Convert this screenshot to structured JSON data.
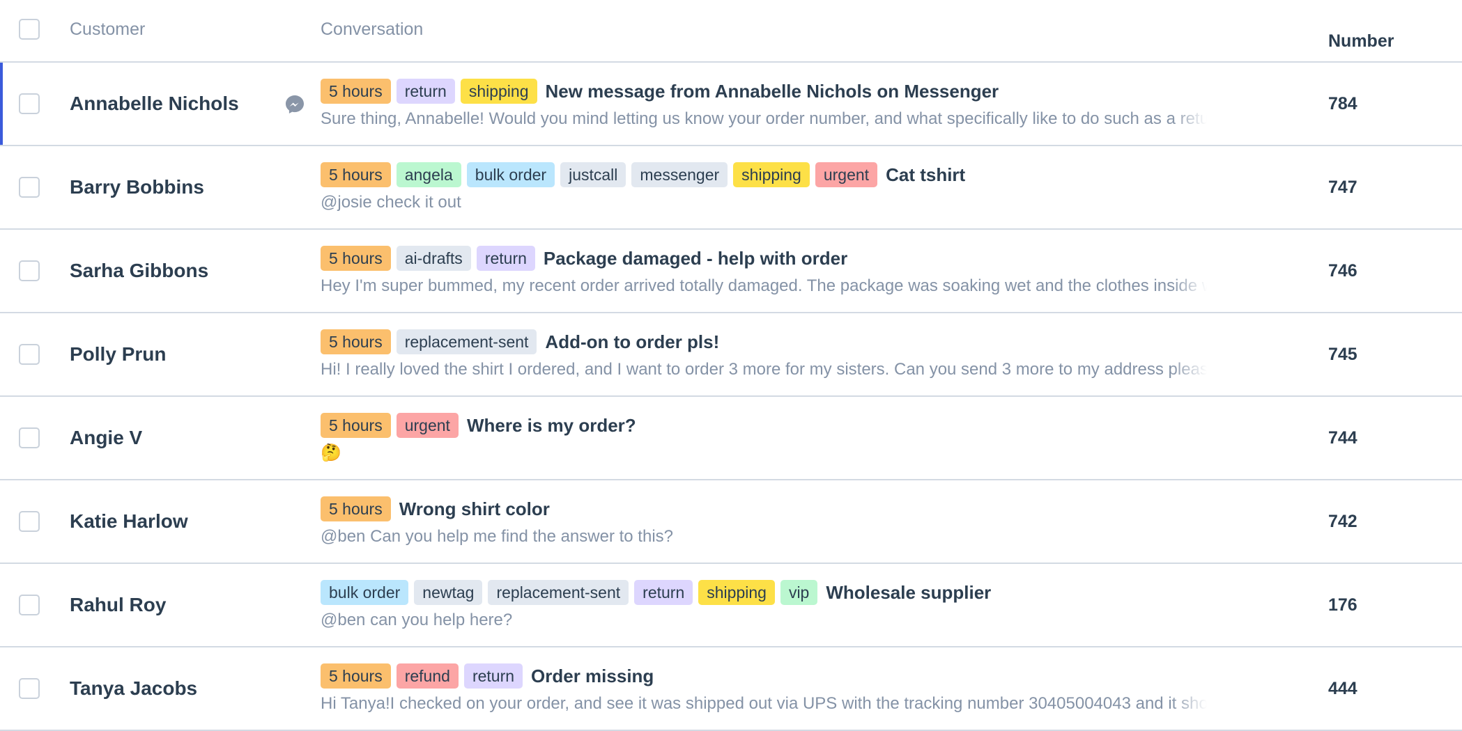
{
  "header": {
    "customer": "Customer",
    "conversation": "Conversation",
    "number": "Number"
  },
  "colors": {
    "accent": "#3b5bdb",
    "text": "#2c3e50",
    "muted": "#8492a6",
    "border": "#d3dae3",
    "tag_orange": "#fbbf6d",
    "tag_purple": "#ddd6fe",
    "tag_yellow": "#fde047",
    "tag_green": "#bbf7d0",
    "tag_blue": "#bae6fd",
    "tag_gray": "#e2e8f0",
    "tag_red": "#fca5a5",
    "messenger_icon": "#8a96a8"
  },
  "rows": [
    {
      "customer": "Annabelle Nichols",
      "selected": true,
      "channel_icon": "messenger-icon",
      "tags": [
        {
          "label": "5 hours",
          "color": "orange"
        },
        {
          "label": "return",
          "color": "purple"
        },
        {
          "label": "shipping",
          "color": "yellow"
        }
      ],
      "subject": "New message from Annabelle Nichols on Messenger",
      "snippet": "Sure thing, Annabelle! Would you mind letting us know your order number, and what specifically like to do such as a return or exchange?",
      "number": "784"
    },
    {
      "customer": "Barry Bobbins",
      "tags": [
        {
          "label": "5 hours",
          "color": "orange"
        },
        {
          "label": "angela",
          "color": "green"
        },
        {
          "label": "bulk order",
          "color": "blue"
        },
        {
          "label": "justcall",
          "color": "gray"
        },
        {
          "label": "messenger",
          "color": "gray"
        },
        {
          "label": "shipping",
          "color": "yellow"
        },
        {
          "label": "urgent",
          "color": "red"
        }
      ],
      "subject": "Cat tshirt",
      "snippet": "@josie check it out",
      "number": "747"
    },
    {
      "customer": "Sarha Gibbons",
      "tags": [
        {
          "label": "5 hours",
          "color": "orange"
        },
        {
          "label": "ai-drafts",
          "color": "gray"
        },
        {
          "label": "return",
          "color": "purple"
        }
      ],
      "subject": "Package damaged - help with order",
      "snippet": "Hey I'm super bummed, my recent order arrived totally damaged. The package was soaking wet and the clothes inside were ruined.",
      "number": "746"
    },
    {
      "customer": "Polly Prun",
      "tags": [
        {
          "label": "5 hours",
          "color": "orange"
        },
        {
          "label": "replacement-sent",
          "color": "gray"
        }
      ],
      "subject": "Add-on to order pls!",
      "snippet": "Hi! I really loved the shirt I ordered, and I want to order 3 more for my sisters. Can you send 3 more to my address please?",
      "number": "745"
    },
    {
      "customer": "Angie V",
      "tags": [
        {
          "label": "5 hours",
          "color": "orange"
        },
        {
          "label": "urgent",
          "color": "red"
        }
      ],
      "subject": "Where is my order?",
      "snippet": "🤔",
      "number": "744"
    },
    {
      "customer": "Katie Harlow",
      "tags": [
        {
          "label": "5 hours",
          "color": "orange"
        }
      ],
      "subject": "Wrong shirt color",
      "snippet": "@ben Can you help me find the answer to this?",
      "number": "742"
    },
    {
      "customer": "Rahul Roy",
      "tags": [
        {
          "label": "bulk order",
          "color": "blue"
        },
        {
          "label": "newtag",
          "color": "gray"
        },
        {
          "label": "replacement-sent",
          "color": "gray"
        },
        {
          "label": "return",
          "color": "purple"
        },
        {
          "label": "shipping",
          "color": "yellow"
        },
        {
          "label": "vip",
          "color": "green"
        }
      ],
      "subject": "Wholesale supplier",
      "snippet": "@ben can you help here?",
      "number": "176"
    },
    {
      "customer": "Tanya Jacobs",
      "tags": [
        {
          "label": "5 hours",
          "color": "orange"
        },
        {
          "label": "refund",
          "color": "red"
        },
        {
          "label": "return",
          "color": "purple"
        }
      ],
      "subject": "Order missing",
      "snippet": "Hi Tanya!I checked on your order, and see it was shipped out via UPS with the tracking number 30405004043 and it shows as delivered.",
      "number": "444"
    }
  ]
}
